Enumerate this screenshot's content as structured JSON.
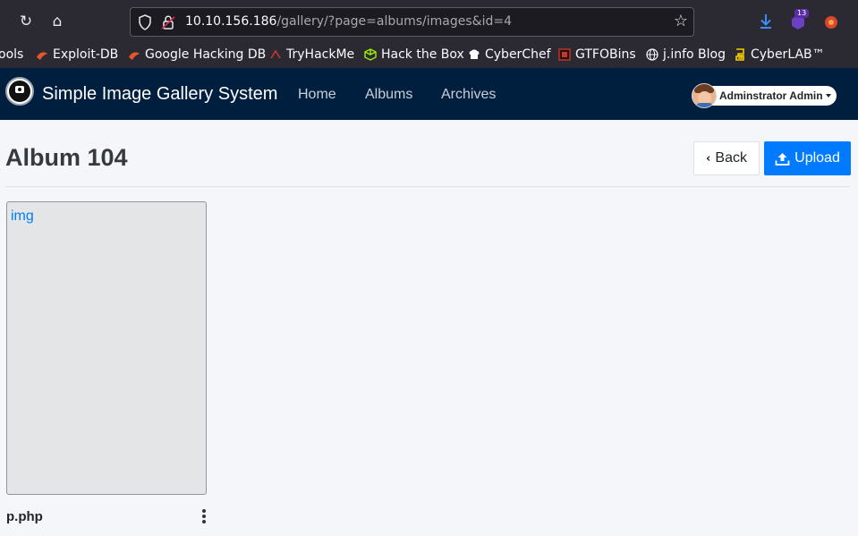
{
  "browser": {
    "url_host": "10.10.156.186",
    "url_path": "/gallery/?page=albums/images&id=4",
    "extension_badge": "13"
  },
  "bookmarks": [
    {
      "label": "ools",
      "icon": "none"
    },
    {
      "label": "Exploit-DB",
      "icon": "exploit-db-icon",
      "color": "#e2582a"
    },
    {
      "label": "Google Hacking DB",
      "icon": "ghdb-icon",
      "color": "#e2582a"
    },
    {
      "label": "TryHackMe",
      "icon": "tryhackme-icon",
      "color": "#c0392b"
    },
    {
      "label": "Hack the Box",
      "icon": "hackthebox-icon",
      "color": "#9fef00"
    },
    {
      "label": "CyberChef",
      "icon": "cyberchef-icon",
      "color": "#ffffff"
    },
    {
      "label": "GTFOBins",
      "icon": "gtfobins-icon",
      "color": "#c0392b"
    },
    {
      "label": "j.info Blog",
      "icon": "globe-icon",
      "color": "#fbfbfe"
    },
    {
      "label": "CyberLAB™",
      "icon": "cyberlab-icon",
      "color": "#f7d000"
    }
  ],
  "app": {
    "brand": "Simple Image Gallery System",
    "nav": [
      "Home",
      "Albums",
      "Archives"
    ],
    "user": "Adminstrator Admin"
  },
  "page": {
    "title": "Album 104",
    "back_label": "Back",
    "upload_label": "Upload"
  },
  "images": [
    {
      "alt": "img",
      "filename": "p.php"
    }
  ],
  "colors": {
    "navbar": "#001f3f",
    "primary": "#007bff",
    "background": "#f4f6f9"
  }
}
